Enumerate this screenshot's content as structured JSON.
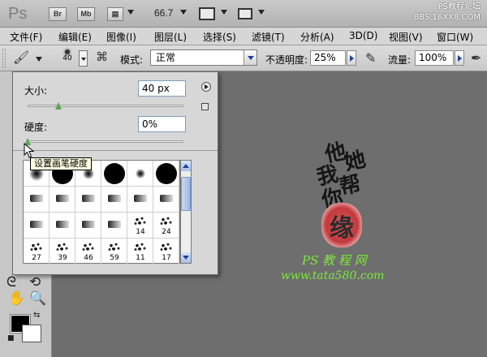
{
  "app": {
    "logo": "Ps",
    "icons": [
      {
        "label": "Br"
      },
      {
        "label": "Mb"
      }
    ],
    "zoom": "66.7"
  },
  "watermark": {
    "line1": "PS教程论坛",
    "line2": "BBS.16XX8.COM"
  },
  "menubar": {
    "items": [
      "文件(F)",
      "编辑(E)",
      "图像(I)",
      "图层(L)",
      "选择(S)",
      "滤镜(T)",
      "分析(A)",
      "3D(D)",
      "视图(V)",
      "窗口(W)"
    ]
  },
  "options": {
    "brush_size": "40",
    "mode_label": "模式:",
    "mode_value": "正常",
    "opacity_label": "不透明度:",
    "opacity_value": "25%",
    "flow_label": "流量:",
    "flow_value": "100%"
  },
  "brush_panel": {
    "size_label": "大小:",
    "size_value": "40 px",
    "size_level": 0.2,
    "hardness_label": "硬度:",
    "hardness_value": "0%",
    "hardness_level": 0.0,
    "tooltip": "设置画笔硬度",
    "presets": [
      {
        "kind": "soft",
        "number": ""
      },
      {
        "kind": "hard",
        "number": ""
      },
      {
        "kind": "soft",
        "number": ""
      },
      {
        "kind": "hard",
        "number": ""
      },
      {
        "kind": "soft",
        "number": ""
      },
      {
        "kind": "hard",
        "number": ""
      },
      {
        "kind": "shape",
        "number": ""
      },
      {
        "kind": "shape",
        "number": ""
      },
      {
        "kind": "shape",
        "number": ""
      },
      {
        "kind": "shape",
        "number": ""
      },
      {
        "kind": "shape",
        "number": ""
      },
      {
        "kind": "shape",
        "number": ""
      },
      {
        "kind": "shape",
        "number": ""
      },
      {
        "kind": "shape",
        "number": ""
      },
      {
        "kind": "shape",
        "number": ""
      },
      {
        "kind": "shape",
        "number": ""
      },
      {
        "kind": "spatter",
        "number": "14"
      },
      {
        "kind": "spatter",
        "number": "24"
      },
      {
        "kind": "spatter",
        "number": "27"
      },
      {
        "kind": "spatter",
        "number": "39"
      },
      {
        "kind": "spatter",
        "number": "46"
      },
      {
        "kind": "spatter",
        "number": "59"
      },
      {
        "kind": "spatter",
        "number": "11"
      },
      {
        "kind": "spatter",
        "number": "17"
      }
    ]
  },
  "artwork": {
    "calligraphy": [
      "他",
      "她",
      "我",
      "帮",
      "你"
    ],
    "seal_char": "缘",
    "site_cn": "PS 教 程 网",
    "site_url": "www.tata580.com"
  },
  "colors": {
    "foreground": "#000000",
    "background": "#ffffff",
    "accent": "#1c3f9e"
  }
}
